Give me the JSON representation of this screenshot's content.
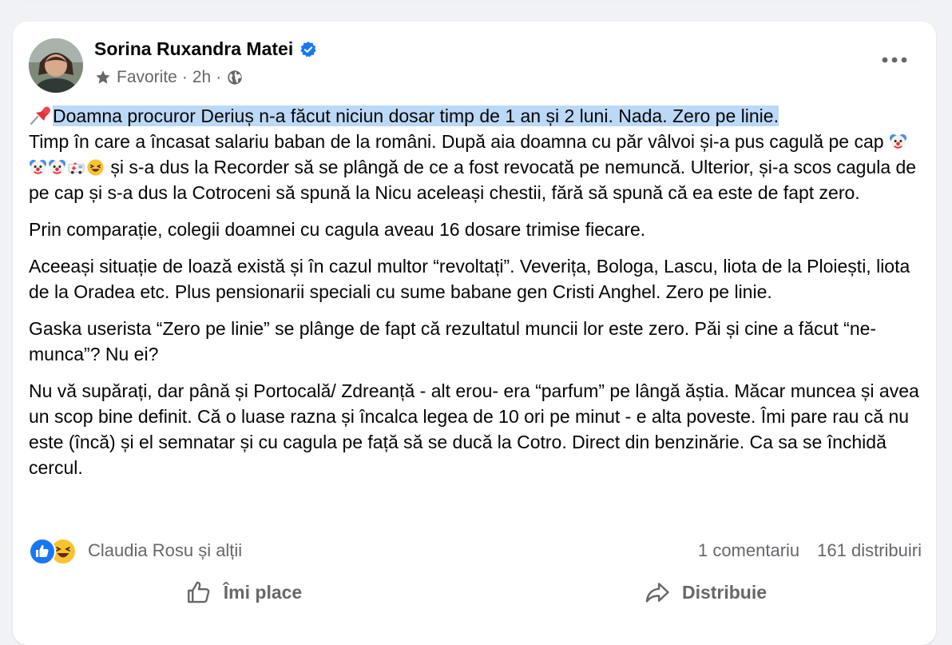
{
  "post": {
    "author": "Sorina Ruxandra Matei",
    "audience_label": "Favorite",
    "separator": "·",
    "time": "2h",
    "privacy_icon": "globe-icon",
    "paragraphs": {
      "p1_highlighted": "Doamna procuror Deriuș n-a făcut niciun dosar timp de 1 an și 2 luni. Nada. Zero pe linie.",
      "p1_line2": "Timp în care a încasat salariu baban de la români. După aia doamna cu păr vâlvoi și-a pus cagulă pe cap",
      "p1_rest": "și s-a dus la Recorder să se plângă de ce a fost revocată pe nemuncă. Ulterior, și-a scos cagula de pe cap și s-a dus la Cotroceni să spună la Nicu aceleași chestii, fără să spună că ea este de fapt zero.",
      "p2": "Prin comparație, colegii doamnei cu cagula aveau 16 dosare trimise fiecare.",
      "p3": "Aceeași situație de loază există și în cazul multor “revoltați”. Veverița, Bologa, Lascu, liota de la Ploiești, liota de la Oradea etc. Plus pensionarii speciali cu sume babane gen Cristi Anghel. Zero pe linie.",
      "p4": "Gaska userista “Zero pe linie” se plânge de fapt că rezultatul muncii lor este zero. Păi și cine a făcut “ne-munca”? Nu ei?",
      "p5": "Nu vă supărați, dar până și Portocală/ Zdreanță - alt erou- era “parfum” pe lângă ăștia. Măcar muncea și avea un scop bine definit. Că o luase razna și încalca legea de 10 ori pe minut - e alta poveste. Îmi pare rau că nu este (încă) și el semnatar și cu cagula pe față să se ducă la Cotro. Direct din benzinărie. Ca sa se închidă cercul."
    },
    "inline_emojis": [
      "clown-face-emoji",
      "clown-face-emoji",
      "clown-face-emoji",
      "ambulance-emoji",
      "laughing-emoji"
    ],
    "reactions": {
      "icons": [
        "like-icon",
        "haha-icon"
      ],
      "names": "Claudia Rosu și alții",
      "comments": "1 comentariu",
      "shares": "161 distribuiri"
    },
    "actions": {
      "like": "Îmi place",
      "share": "Distribuie"
    }
  },
  "colors": {
    "accent_blue": "#1877f2",
    "highlight": "#bcd8f7",
    "secondary_text": "#65676b",
    "background": "#f0f2f5"
  }
}
